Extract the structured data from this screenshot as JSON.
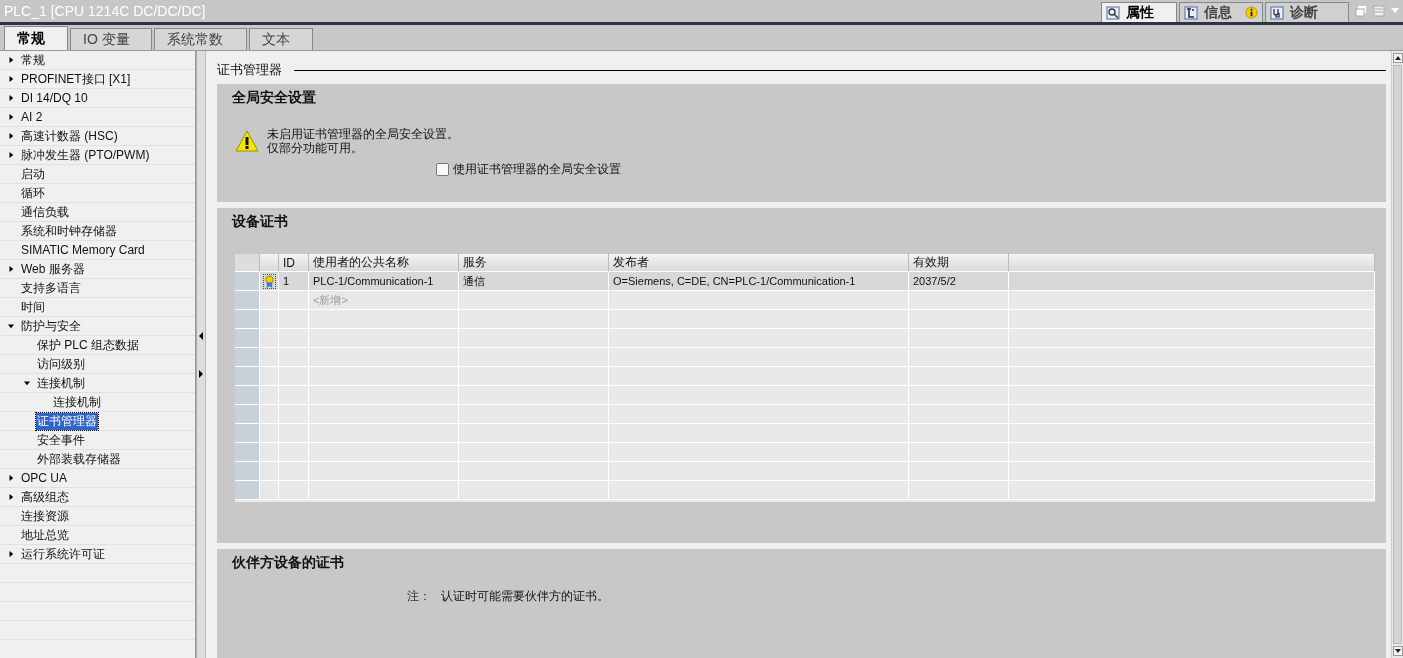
{
  "window": {
    "title": "PLC_1 [CPU 1214C DC/DC/DC]"
  },
  "inspector_tabs": [
    {
      "label": "属性",
      "selected": true,
      "badge": false
    },
    {
      "label": "信息",
      "selected": false,
      "badge": true
    },
    {
      "label": "诊断",
      "selected": false,
      "badge": false
    }
  ],
  "tabs": [
    {
      "label": "常规",
      "selected": true
    },
    {
      "label": "IO 变量",
      "selected": false
    },
    {
      "label": "系统常数",
      "selected": false
    },
    {
      "label": "文本",
      "selected": false
    }
  ],
  "tree": [
    {
      "label": "常规",
      "kind": "folder",
      "expanded": false,
      "selected": false
    },
    {
      "label": "PROFINET接口 [X1]",
      "kind": "folder",
      "expanded": false,
      "selected": false
    },
    {
      "label": "DI 14/DQ 10",
      "kind": "folder",
      "expanded": false,
      "selected": false
    },
    {
      "label": "AI 2",
      "kind": "folder",
      "expanded": false,
      "selected": false
    },
    {
      "label": "高速计数器 (HSC)",
      "kind": "folder",
      "expanded": false,
      "selected": false
    },
    {
      "label": "脉冲发生器 (PTO/PWM)",
      "kind": "folder",
      "expanded": false,
      "selected": false
    },
    {
      "label": "启动",
      "kind": "leaf",
      "selected": false
    },
    {
      "label": "循环",
      "kind": "leaf",
      "selected": false
    },
    {
      "label": "通信负载",
      "kind": "leaf",
      "selected": false
    },
    {
      "label": "系统和时钟存储器",
      "kind": "leaf",
      "selected": false
    },
    {
      "label": "SIMATIC Memory Card",
      "kind": "leaf",
      "selected": false
    },
    {
      "label": "Web 服务器",
      "kind": "folder",
      "expanded": false,
      "selected": false
    },
    {
      "label": "支持多语言",
      "kind": "leaf",
      "selected": false
    },
    {
      "label": "时间",
      "kind": "leaf",
      "selected": false
    },
    {
      "label": "防护与安全",
      "kind": "folder",
      "expanded": true,
      "selected": false,
      "children": [
        {
          "label": "保护 PLC 组态数据",
          "kind": "leaf",
          "selected": false
        },
        {
          "label": "访问级别",
          "kind": "leaf",
          "selected": false
        },
        {
          "label": "连接机制",
          "kind": "folder",
          "expanded": true,
          "selected": false,
          "children": [
            {
              "label": "连接机制",
              "kind": "leaf",
              "selected": false
            }
          ]
        },
        {
          "label": "证书管理器",
          "kind": "leaf",
          "selected": true
        },
        {
          "label": "安全事件",
          "kind": "leaf",
          "selected": false
        },
        {
          "label": "外部装载存储器",
          "kind": "leaf",
          "selected": false
        }
      ]
    },
    {
      "label": "OPC UA",
      "kind": "folder",
      "expanded": false,
      "selected": false
    },
    {
      "label": "高级组态",
      "kind": "folder",
      "expanded": false,
      "selected": false
    },
    {
      "label": "连接资源",
      "kind": "leaf",
      "selected": false
    },
    {
      "label": "地址总览",
      "kind": "leaf",
      "selected": false
    },
    {
      "label": "运行系统许可证",
      "kind": "folder",
      "expanded": false,
      "selected": false
    }
  ],
  "page_title": "证书管理器",
  "global_security": {
    "heading": "全局安全设置",
    "warning_lines": [
      "未启用证书管理器的全局安全设置。",
      "仅部分功能可用。"
    ],
    "checkbox": {
      "label": "使用证书管理器的全局安全设置",
      "checked": false
    }
  },
  "device_certificates": {
    "heading": "设备证书",
    "table": {
      "columns": [
        "ID",
        "使用者的公共名称",
        "服务",
        "发布者",
        "有效期"
      ],
      "rows": [
        {
          "id": "1",
          "name": "PLC-1/Communication-1",
          "service": "通信",
          "issuer": "O=Siemens, C=DE, CN=PLC-1/Communication-1",
          "validity": "2037/5/2",
          "selected": true
        }
      ],
      "add_row": "<新增>"
    }
  },
  "partner_certificates": {
    "heading": "伙伴方设备的证书",
    "note_label": "注：",
    "note": "认证时可能需要伙伴方的证书。"
  }
}
